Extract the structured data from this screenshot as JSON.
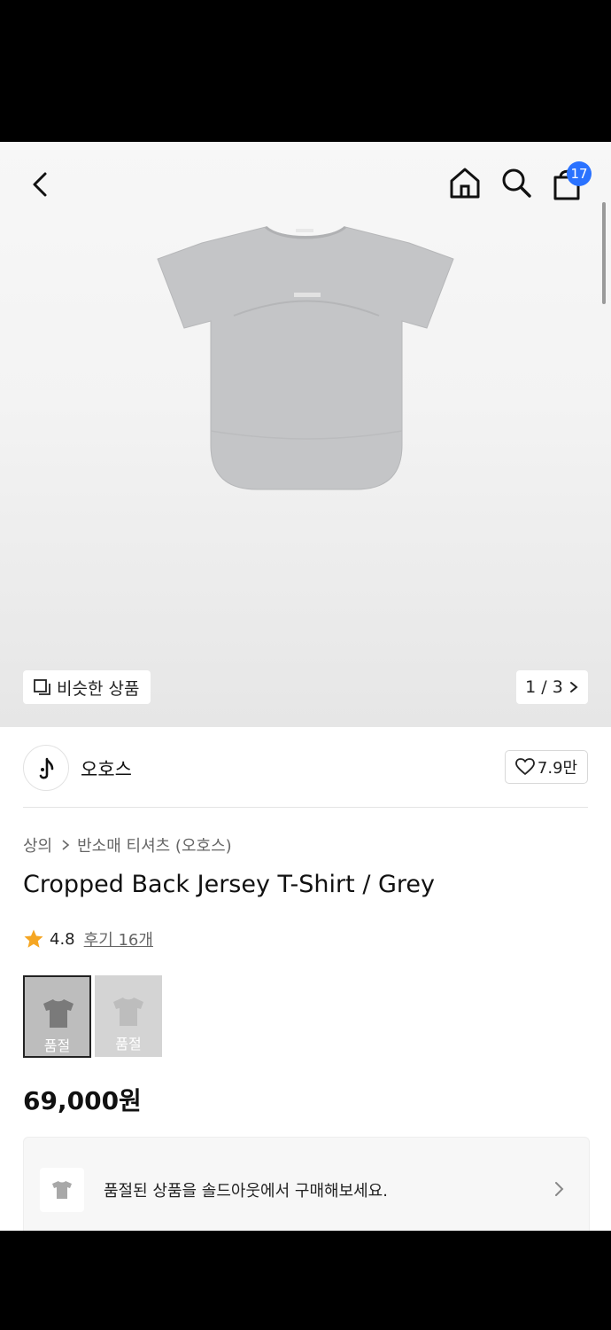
{
  "header": {
    "cart_count": "17",
    "icons": [
      "back-icon",
      "home-icon",
      "search-icon",
      "bag-icon"
    ]
  },
  "gallery": {
    "similar_label": "비슷한 상품",
    "pager": "1 / 3"
  },
  "brand": {
    "name": "오호스",
    "likes": "7.9만"
  },
  "breadcrumb": {
    "category": "상의",
    "subcategory": "반소매 티셔츠 (오호스)"
  },
  "product": {
    "title": "Cropped Back Jersey T-Shirt / Grey",
    "rating": "4.8",
    "reviews": "후기 16개",
    "price": "69,000원",
    "options": [
      {
        "label": "품절",
        "color": "#7a7a7a"
      },
      {
        "label": "품절",
        "color": "#bdbdbd"
      }
    ]
  },
  "banner": {
    "text": "품절된 상품을 솔드아웃에서 구매해보세요."
  },
  "colors": {
    "accent": "#2a72ff",
    "star": "#f5a623",
    "shirt": "#c4c5c7"
  }
}
